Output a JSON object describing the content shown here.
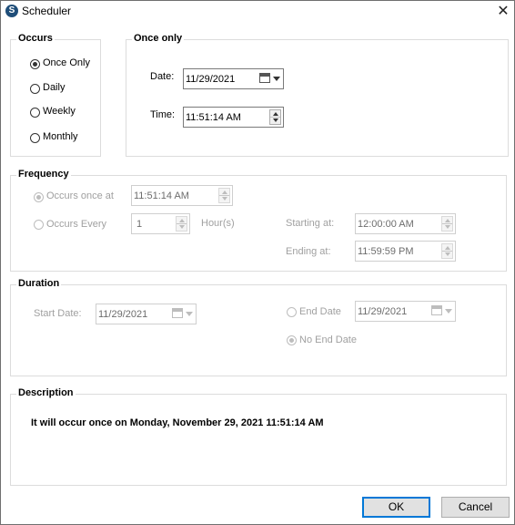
{
  "window": {
    "title": "Scheduler",
    "close_glyph": "✕",
    "icon_letter": "S"
  },
  "occurs": {
    "title": "Occurs",
    "options": [
      {
        "label": "Once Only",
        "selected": true
      },
      {
        "label": "Daily",
        "selected": false
      },
      {
        "label": "Weekly",
        "selected": false
      },
      {
        "label": "Monthly",
        "selected": false
      }
    ]
  },
  "once_only": {
    "title": "Once only",
    "date_label": "Date:",
    "date_value": "11/29/2021",
    "time_label": "Time:",
    "time_value": "11:51:14 AM"
  },
  "frequency": {
    "title": "Frequency",
    "occurs_once_at_label": "Occurs once at",
    "occurs_once_at_value": "11:51:14 AM",
    "occurs_every_label": "Occurs Every",
    "occurs_every_value": "1",
    "unit_label": "Hour(s)",
    "starting_at_label": "Starting at:",
    "starting_at_value": "12:00:00 AM",
    "ending_at_label": "Ending at:",
    "ending_at_value": "11:59:59 PM"
  },
  "duration": {
    "title": "Duration",
    "start_date_label": "Start Date:",
    "start_date_value": "11/29/2021",
    "end_date_label": "End Date",
    "end_date_value": "11/29/2021",
    "no_end_date_label": "No End Date"
  },
  "description": {
    "title": "Description",
    "text": "It will occur once on Monday, November 29, 2021 11:51:14 AM"
  },
  "buttons": {
    "ok": "OK",
    "cancel": "Cancel"
  },
  "colors": {
    "accent": "#0078d7",
    "disabled_text": "#a0a0a0",
    "group_border": "#dcdcdc"
  }
}
